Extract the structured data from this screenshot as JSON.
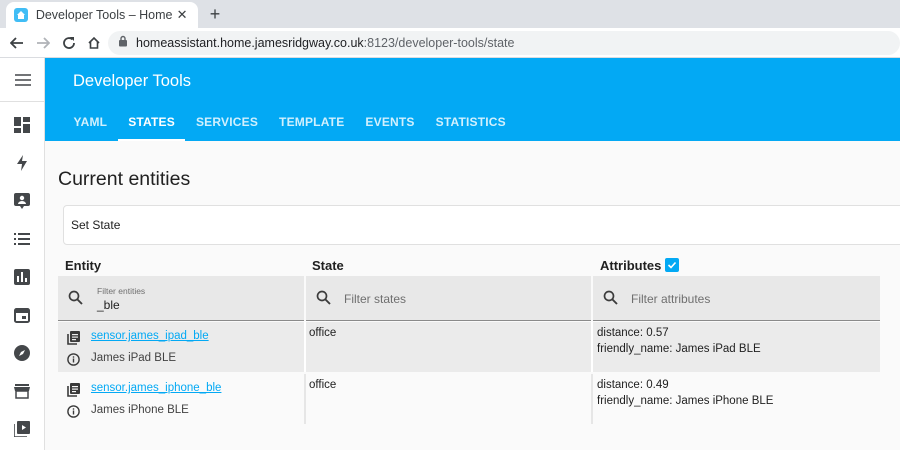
{
  "browser": {
    "tab_title": "Developer Tools – Home A",
    "tab_close": "✕",
    "new_tab": "+",
    "url_host": "homeassistant.home.jamesridgway.co.uk",
    "url_rest": ":8123/developer-tools/state"
  },
  "header": {
    "title": "Developer Tools",
    "tabs": [
      {
        "label": "YAML",
        "active": false
      },
      {
        "label": "STATES",
        "active": true
      },
      {
        "label": "SERVICES",
        "active": false
      },
      {
        "label": "TEMPLATE",
        "active": false
      },
      {
        "label": "EVENTS",
        "active": false
      },
      {
        "label": "STATISTICS",
        "active": false
      }
    ]
  },
  "sidebar": {
    "icons": [
      "menu-icon",
      "overview-icon",
      "energy-icon",
      "logbook-icon",
      "history-list-icon",
      "statistics-icon",
      "calendar-icon",
      "map-icon",
      "store-icon",
      "media-icon"
    ]
  },
  "main": {
    "title": "Current entities",
    "set_state_label": "Set State",
    "columns": {
      "entity": "Entity",
      "state": "State",
      "attributes": "Attributes"
    },
    "attributes_checked": true,
    "filters": {
      "entity_label": "Filter entities",
      "entity_value": "_ble",
      "state_placeholder": "Filter states",
      "attributes_placeholder": "Filter attributes"
    },
    "rows": [
      {
        "entity_id": "sensor.james_ipad_ble",
        "friendly_name": "James iPad BLE",
        "state": "office",
        "attributes": [
          "distance: 0.57",
          "friendly_name: James iPad BLE"
        ]
      },
      {
        "entity_id": "sensor.james_iphone_ble",
        "friendly_name": "James iPhone BLE",
        "state": "office",
        "attributes": [
          "distance: 0.49",
          "friendly_name: James iPhone BLE"
        ]
      }
    ]
  },
  "colors": {
    "primary": "#03a9f4",
    "row_shade": "#ebebeb",
    "filter_bg": "#e8e8e8"
  }
}
